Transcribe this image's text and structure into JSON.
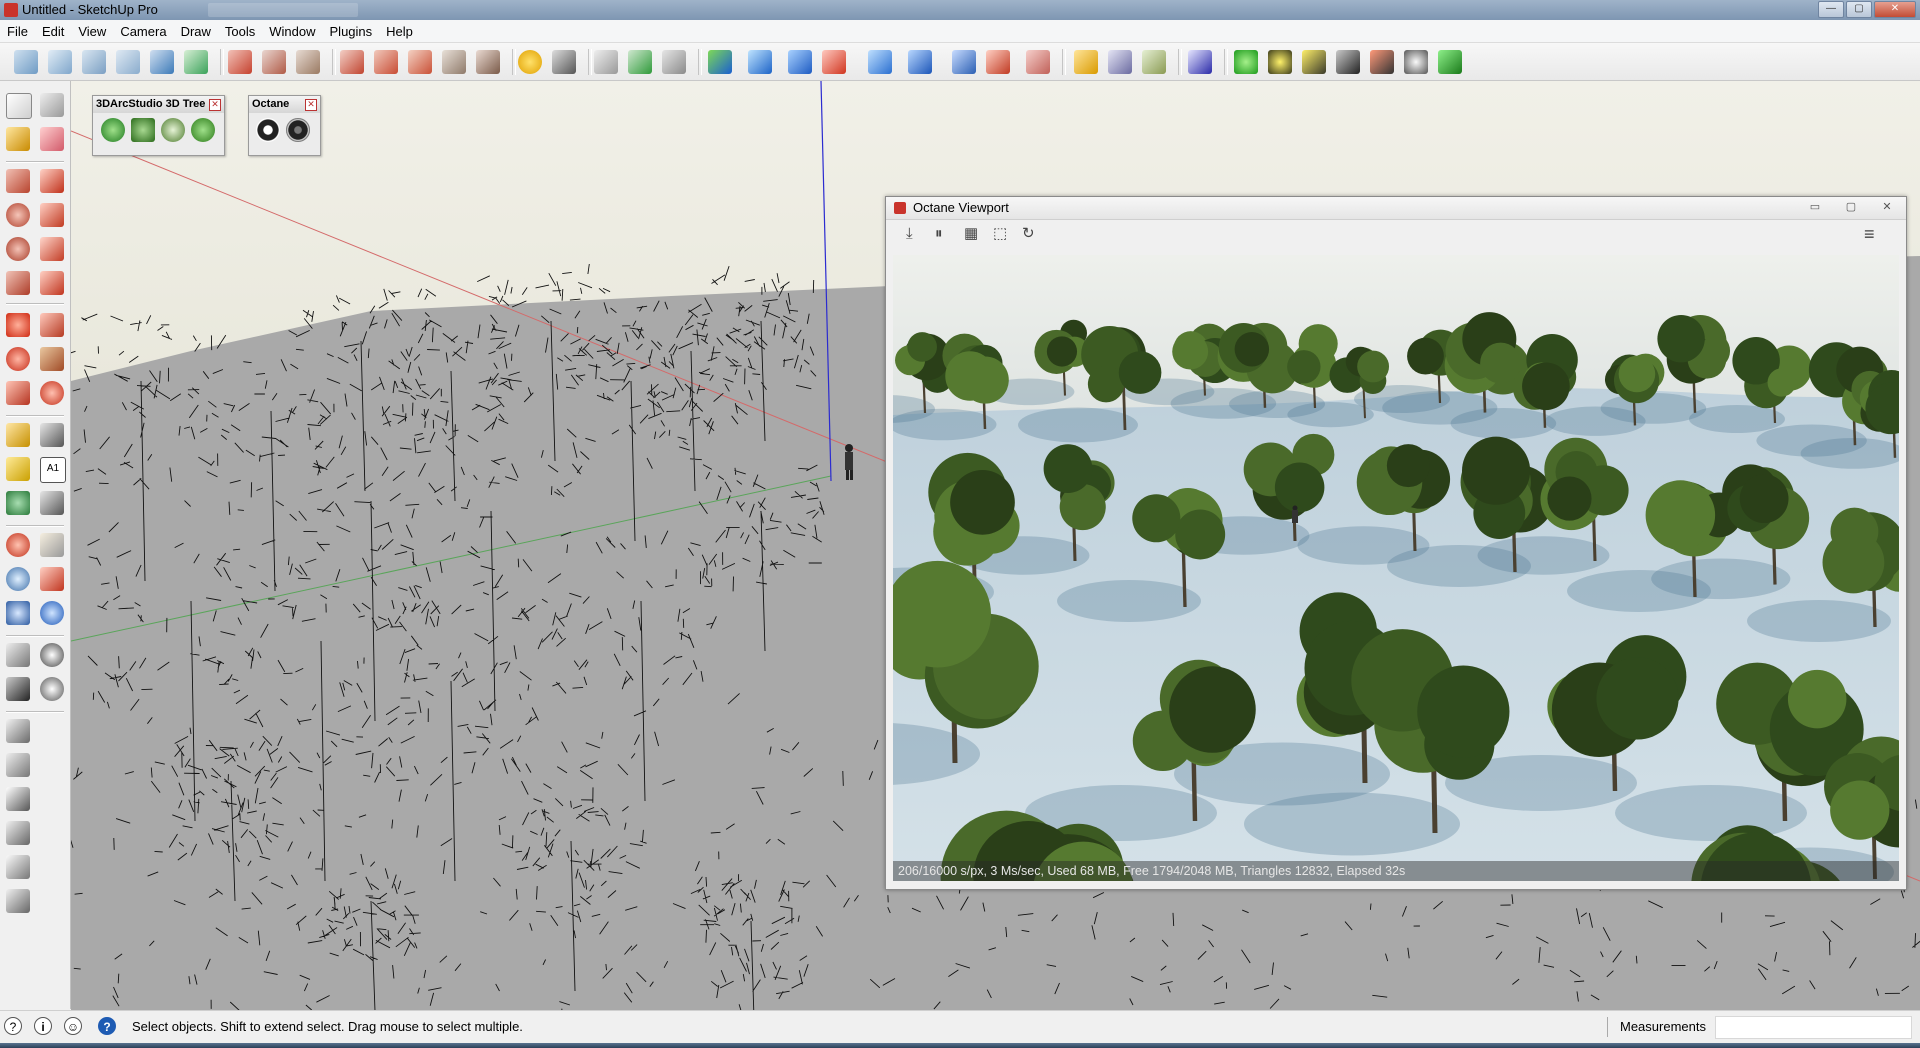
{
  "window": {
    "title": "Untitled - SketchUp Pro"
  },
  "menu": [
    "File",
    "Edit",
    "View",
    "Camera",
    "Draw",
    "Tools",
    "Window",
    "Plugins",
    "Help"
  ],
  "toolbar": {
    "icons": [
      "views-iso",
      "views-top",
      "views-front",
      "views-right",
      "views-back",
      "views-left",
      "xray",
      "wireframe",
      "hidden-line",
      "shaded",
      "shaded-textures",
      "monochrome",
      "section-plane",
      "section-display",
      "section-cuts",
      "protractor",
      "tools",
      "paint-bucket",
      "sandbox-from-contours",
      "sandbox-from-scratch",
      "smoove",
      "stamp",
      "drape",
      "add-detail",
      "flip-edge",
      "solid-tools",
      "follow-me",
      "intersect",
      "outer-shell",
      "component",
      "group",
      "explode",
      "components-panel",
      "materials",
      "styles",
      "fredo6",
      "octane-start",
      "octane-sun",
      "octane-light",
      "octane-export",
      "octane-render",
      "octane-settings",
      "octane-camera"
    ]
  },
  "palettes": {
    "tree": {
      "title": "3DArcStudio 3D Tree ...",
      "close": "✕"
    },
    "octane": {
      "title": "Octane",
      "close": "✕"
    }
  },
  "octane": {
    "title": "Octane Viewport",
    "min": "▭",
    "max": "▢",
    "close": "✕",
    "tools": {
      "save": "⤓",
      "pause": "⏸",
      "channels": "▦",
      "region": "⬚",
      "restart": "↻",
      "menu": "≡"
    },
    "stats": "206/16000 s/px, 3 Ms/sec, Used 68 MB, Free 1794/2048 MB, Triangles 12832, Elapsed 32s"
  },
  "status": {
    "message": "Select objects. Shift to extend select. Drag mouse to select multiple.",
    "measurements_label": "Measurements",
    "measurements_value": "",
    "icons": {
      "geo": "?",
      "credits": "i",
      "user": "☺",
      "help": "?"
    }
  }
}
